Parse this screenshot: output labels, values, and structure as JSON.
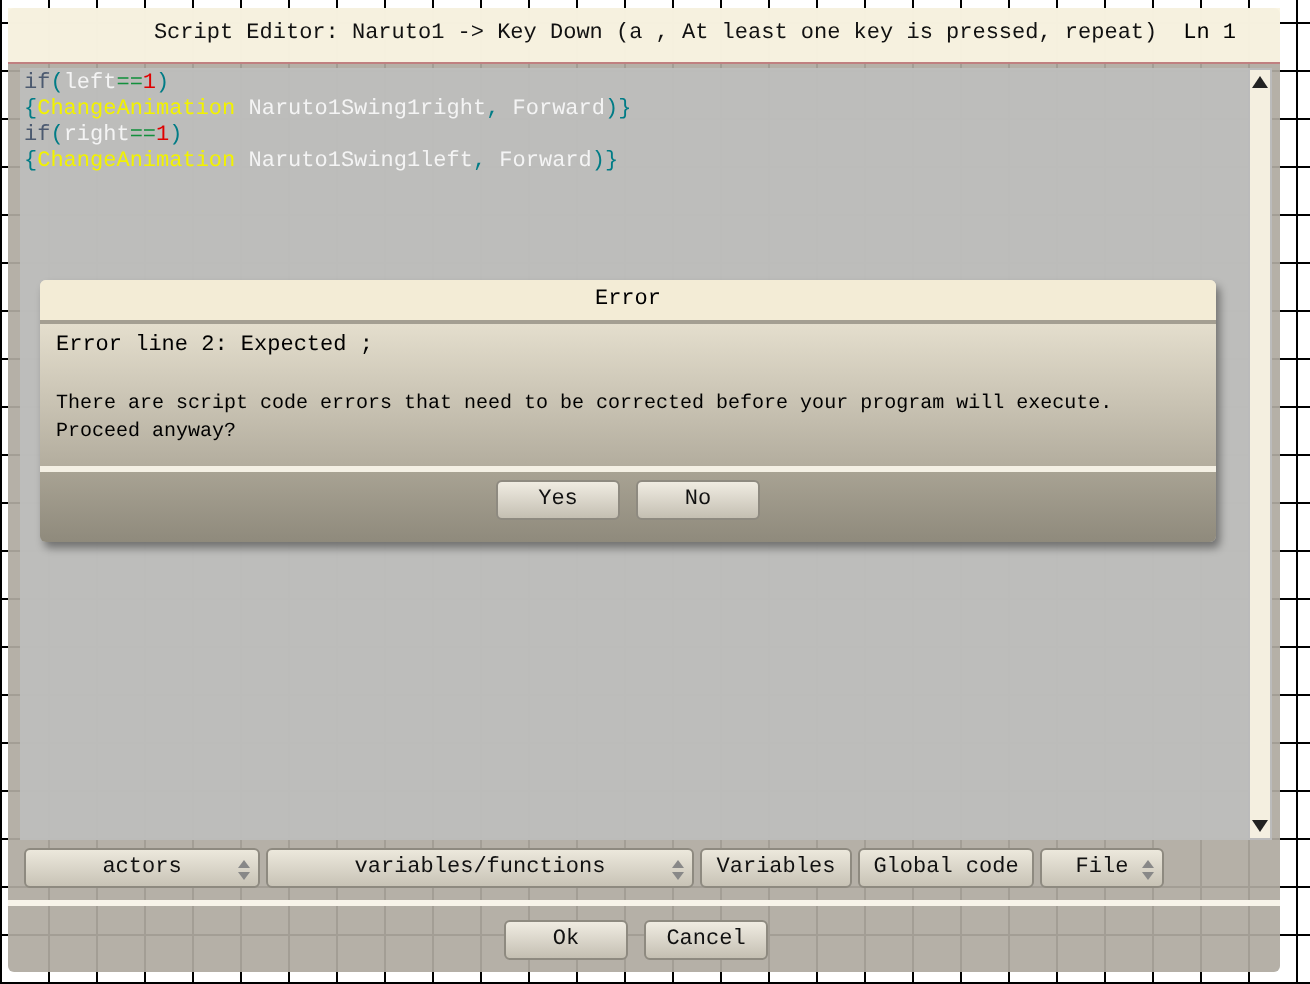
{
  "window": {
    "title": "Script Editor: Naruto1 -> Key Down (a , At least one key is pressed, repeat)",
    "line_indicator": "Ln 1"
  },
  "code_lines": [
    [
      {
        "kind": "keyword",
        "text": "if"
      },
      {
        "kind": "punct",
        "text": "("
      },
      {
        "kind": "ident",
        "text": "left"
      },
      {
        "kind": "operator",
        "text": "=="
      },
      {
        "kind": "number",
        "text": "1"
      },
      {
        "kind": "punct",
        "text": ")"
      }
    ],
    [
      {
        "kind": "punct",
        "text": "{"
      },
      {
        "kind": "function",
        "text": "ChangeAnimation"
      },
      {
        "kind": "ident",
        "text": " Naruto1Swing1right"
      },
      {
        "kind": "punct",
        "text": ","
      },
      {
        "kind": "ident",
        "text": " Forward"
      },
      {
        "kind": "punct",
        "text": ")}"
      }
    ],
    [
      {
        "kind": "keyword",
        "text": "if"
      },
      {
        "kind": "punct",
        "text": "("
      },
      {
        "kind": "ident",
        "text": "right"
      },
      {
        "kind": "operator",
        "text": "=="
      },
      {
        "kind": "number",
        "text": "1"
      },
      {
        "kind": "punct",
        "text": ")"
      }
    ],
    [
      {
        "kind": "punct",
        "text": "{"
      },
      {
        "kind": "function",
        "text": "ChangeAnimation"
      },
      {
        "kind": "ident",
        "text": " Naruto1Swing1left"
      },
      {
        "kind": "punct",
        "text": ","
      },
      {
        "kind": "ident",
        "text": " Forward"
      },
      {
        "kind": "punct",
        "text": ")}"
      }
    ]
  ],
  "toolbar": [
    {
      "kind": "dropdown",
      "label": "actors"
    },
    {
      "kind": "dropdown",
      "label": "variables/functions"
    },
    {
      "kind": "button",
      "label": "Variables"
    },
    {
      "kind": "button",
      "label": "Global code"
    },
    {
      "kind": "dropdown",
      "label": "File"
    }
  ],
  "buttons": [
    "Ok",
    "Cancel"
  ],
  "dialog": {
    "title": "Error",
    "error": "Error line 2: Expected  ;",
    "message": "There are script code errors that need to be corrected before your program will execute.\nProceed anyway?",
    "buttons": [
      "Yes",
      "No"
    ]
  }
}
